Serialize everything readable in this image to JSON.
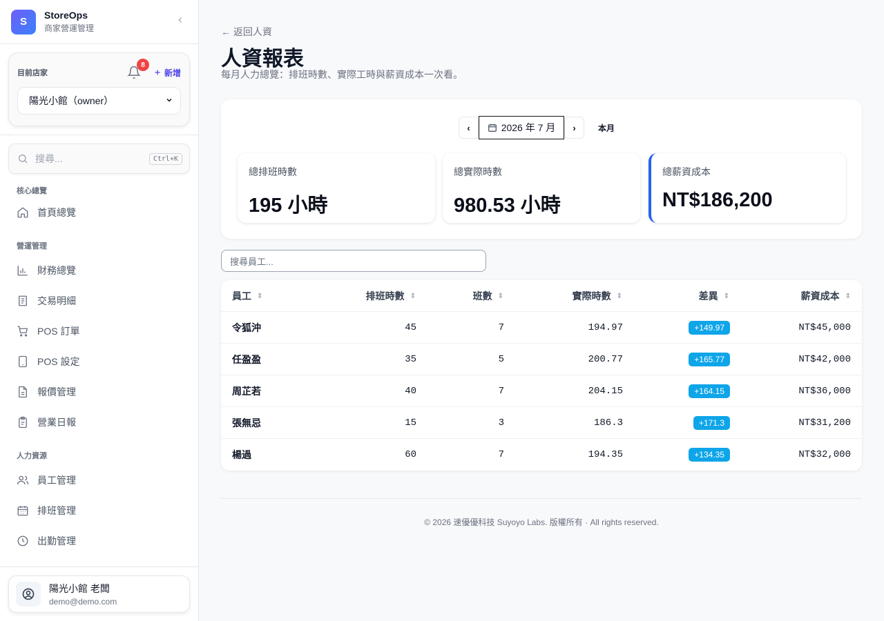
{
  "brand": {
    "logo_letter": "S",
    "name": "StoreOps",
    "subtitle": "商家營運管理"
  },
  "store": {
    "label": "目前店家",
    "notification_count": "8",
    "add_label": "新增",
    "selected": "陽光小館（owner）"
  },
  "search": {
    "placeholder": "搜尋...",
    "shortcut": "Ctrl+K"
  },
  "nav": {
    "sections": [
      {
        "title": "核心總覽",
        "items": [
          {
            "label": "首頁總覽",
            "icon": "home-icon"
          }
        ]
      },
      {
        "title": "營運管理",
        "items": [
          {
            "label": "財務總覽",
            "icon": "bar-chart-icon"
          },
          {
            "label": "交易明細",
            "icon": "document-icon"
          },
          {
            "label": "POS 訂單",
            "icon": "cart-icon"
          },
          {
            "label": "POS 設定",
            "icon": "tablet-icon"
          },
          {
            "label": "報價管理",
            "icon": "file-text-icon"
          },
          {
            "label": "營業日報",
            "icon": "clipboard-icon"
          }
        ]
      },
      {
        "title": "人力資源",
        "items": [
          {
            "label": "員工管理",
            "icon": "users-icon"
          },
          {
            "label": "排班管理",
            "icon": "calendar-icon"
          },
          {
            "label": "出勤管理",
            "icon": "clock-icon"
          }
        ]
      }
    ]
  },
  "user": {
    "name": "陽光小館 老闆",
    "email": "demo@demo.com"
  },
  "page": {
    "back_label": "← 返回人資",
    "title": "人資報表",
    "subtitle": "每月人力總覽：排班時數、實際工時與薪資成本一次看。"
  },
  "month_nav": {
    "prev": "‹",
    "next": "›",
    "month": "2026 年 7 月",
    "this_month": "本月"
  },
  "stats": [
    {
      "label": "總排班時數",
      "value": "195 小時"
    },
    {
      "label": "總實際時數",
      "value": "980.53 小時"
    },
    {
      "label": "總薪資成本",
      "value": "NT$186,200"
    }
  ],
  "employee_search": {
    "placeholder": "搜尋員工..."
  },
  "table": {
    "columns": [
      "員工",
      "排班時數",
      "班數",
      "實際時數",
      "差異",
      "薪資成本"
    ],
    "rows": [
      {
        "name": "令狐沖",
        "scheduled": "45",
        "shifts": "7",
        "actual": "194.97",
        "diff": "+149.97",
        "cost": "NT$45,000"
      },
      {
        "name": "任盈盈",
        "scheduled": "35",
        "shifts": "5",
        "actual": "200.77",
        "diff": "+165.77",
        "cost": "NT$42,000"
      },
      {
        "name": "周芷若",
        "scheduled": "40",
        "shifts": "7",
        "actual": "204.15",
        "diff": "+164.15",
        "cost": "NT$36,000"
      },
      {
        "name": "張無忌",
        "scheduled": "15",
        "shifts": "3",
        "actual": "186.3",
        "diff": "+171.3",
        "cost": "NT$31,200"
      },
      {
        "name": "楊過",
        "scheduled": "60",
        "shifts": "7",
        "actual": "194.35",
        "diff": "+134.35",
        "cost": "NT$32,000"
      }
    ]
  },
  "footer": {
    "text": "© 2026 速優優科技 Suyoyo Labs. 版權所有 · All rights reserved."
  },
  "colors": {
    "accent": "#2563eb",
    "pill": "#0ea5e9",
    "badge": "#ef4444",
    "brand_gradient_start": "#6d5efc",
    "brand_gradient_end": "#3b82f6"
  }
}
